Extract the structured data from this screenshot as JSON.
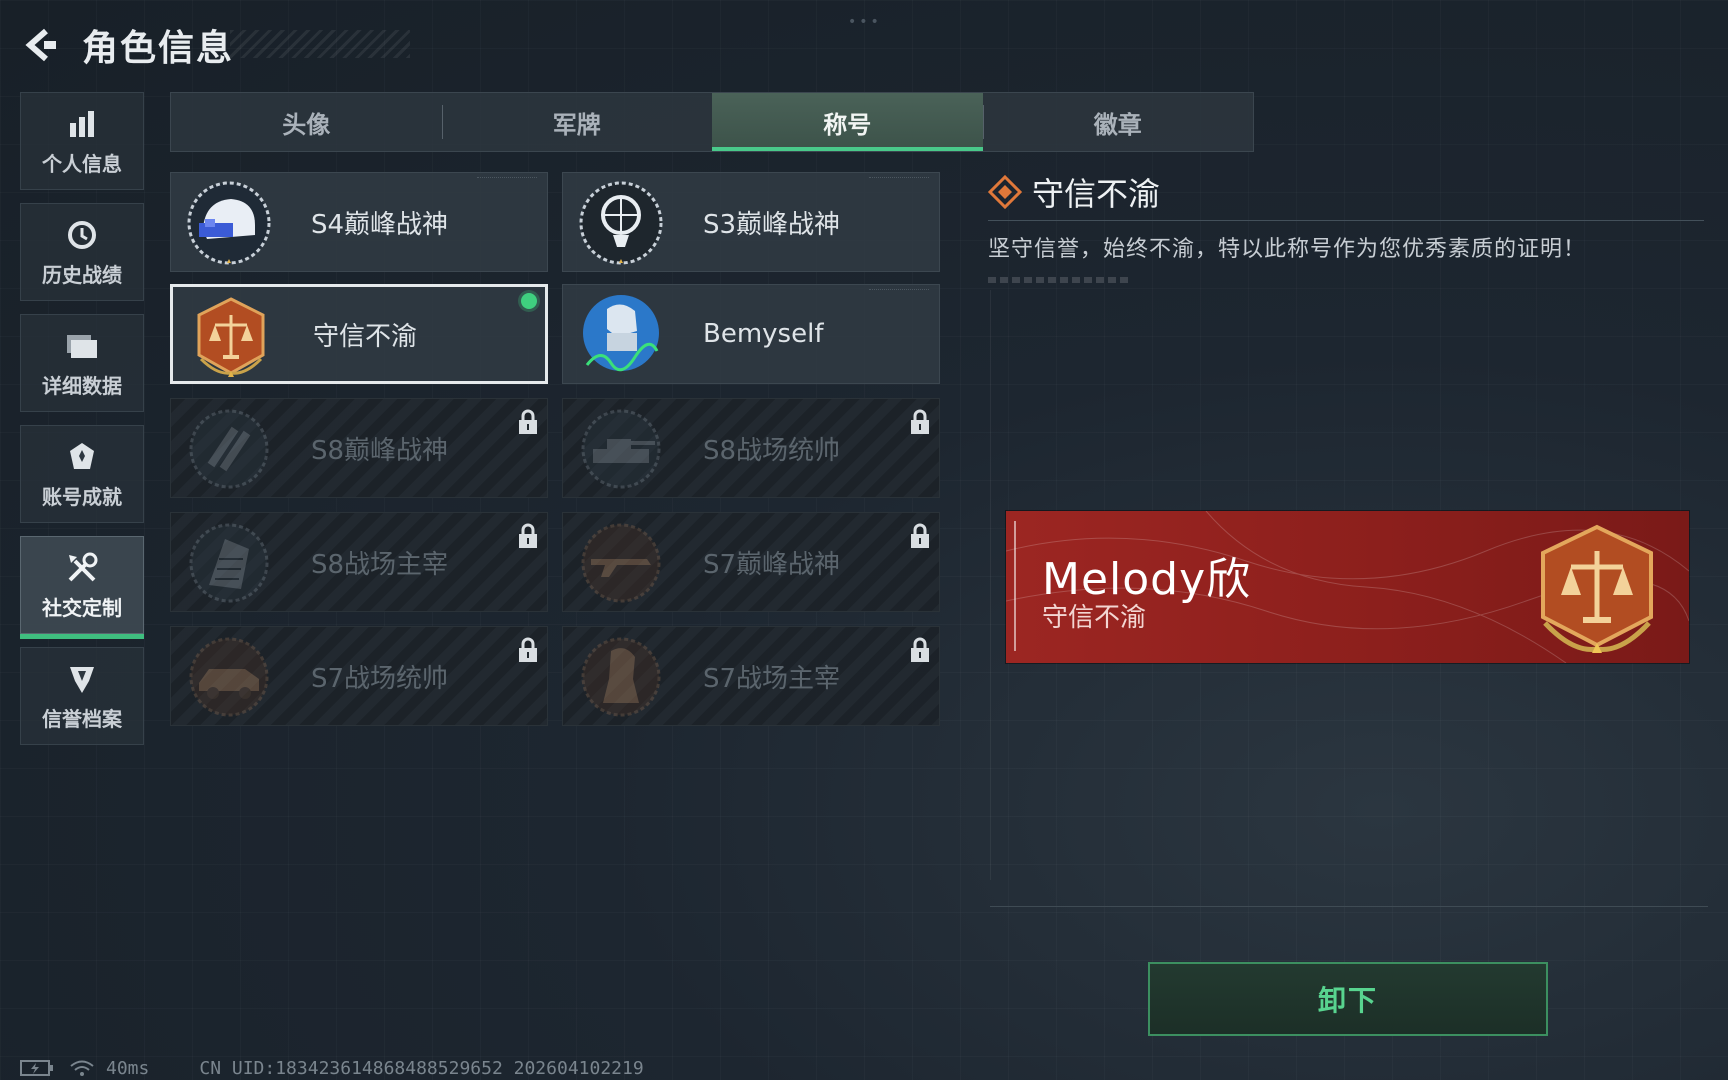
{
  "header": {
    "title": "角色信息"
  },
  "sidebar": {
    "items": [
      {
        "label": "个人信息",
        "icon": "bar-chart-icon"
      },
      {
        "label": "历史战绩",
        "icon": "history-clock-icon"
      },
      {
        "label": "详细数据",
        "icon": "folder-icon"
      },
      {
        "label": "账号成就",
        "icon": "achievement-icon"
      },
      {
        "label": "社交定制",
        "icon": "tools-icon",
        "active": true
      },
      {
        "label": "信誉档案",
        "icon": "shield-icon"
      }
    ]
  },
  "tabs": [
    {
      "label": "头像"
    },
    {
      "label": "军牌"
    },
    {
      "label": "称号",
      "active": true
    },
    {
      "label": "徽章"
    }
  ],
  "titles": [
    {
      "name": "S4巅峰战神",
      "locked": false
    },
    {
      "name": "S3巅峰战神",
      "locked": false
    },
    {
      "name": "守信不渝",
      "locked": false,
      "selected": true,
      "equipped": true
    },
    {
      "name": "Bemyself",
      "locked": false
    },
    {
      "name": "S8巅峰战神",
      "locked": true
    },
    {
      "name": "S8战场统帅",
      "locked": true
    },
    {
      "name": "S8战场主宰",
      "locked": true
    },
    {
      "name": "S7巅峰战神",
      "locked": true
    },
    {
      "name": "S7战场统帅",
      "locked": true
    },
    {
      "name": "S7战场主宰",
      "locked": true
    }
  ],
  "detail": {
    "title": "守信不渝",
    "description": "坚守信誉，始终不渝，特以此称号作为您优秀素质的证明！"
  },
  "preview": {
    "player_name": "Melody欣",
    "title": "守信不渝"
  },
  "actions": {
    "unequip_label": "卸下"
  },
  "status": {
    "ping": "40ms",
    "uid": "CN UID:183423614868488529652 202604102219"
  },
  "colors": {
    "accent_green": "#49c98a",
    "banner_red": "#9c2622",
    "emblem_orange": "#c0582a"
  }
}
